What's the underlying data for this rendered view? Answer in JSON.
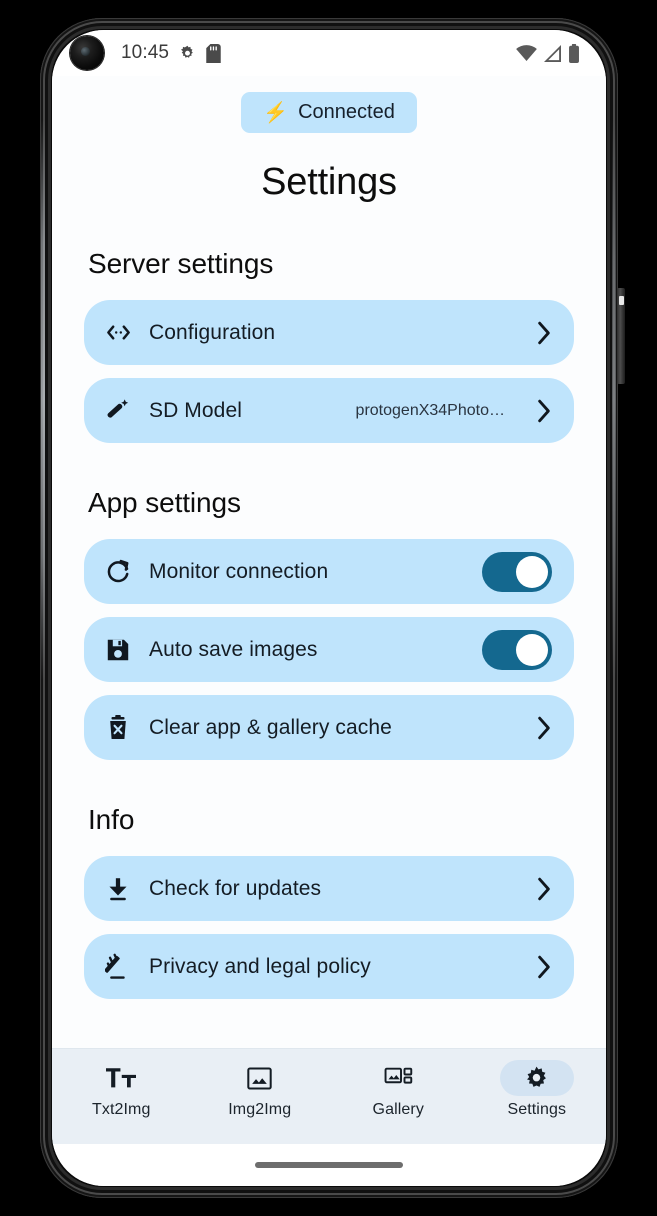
{
  "status_bar": {
    "time": "10:45",
    "icons_left": [
      "gear-icon",
      "sd-card-icon"
    ],
    "icons_right": [
      "wifi-icon",
      "cellular-signal-icon",
      "battery-icon"
    ]
  },
  "header": {
    "connection_badge": {
      "icon": "⚡",
      "label": "Connected"
    },
    "title": "Settings"
  },
  "sections": [
    {
      "header": "Server settings",
      "rows": [
        {
          "icon": "code-icon",
          "label": "Configuration",
          "value": "",
          "control": "chevron"
        },
        {
          "icon": "magic-wand-icon",
          "label": "SD Model",
          "value": "protogenX34Photo…",
          "control": "chevron"
        }
      ]
    },
    {
      "header": "App settings",
      "rows": [
        {
          "icon": "refresh-icon",
          "label": "Monitor connection",
          "value": "",
          "control": "toggle",
          "toggle_on": true
        },
        {
          "icon": "floppy-save-icon",
          "label": "Auto save images",
          "value": "",
          "control": "toggle",
          "toggle_on": true
        },
        {
          "icon": "trash-delete-icon",
          "label": "Clear app & gallery cache",
          "value": "",
          "control": "chevron"
        }
      ]
    },
    {
      "header": "Info",
      "rows": [
        {
          "icon": "download-icon",
          "label": "Check for updates",
          "value": "",
          "control": "chevron"
        },
        {
          "icon": "gavel-icon",
          "label": "Privacy and legal policy",
          "value": "",
          "control": "chevron"
        }
      ]
    }
  ],
  "bottom_nav": {
    "items": [
      {
        "icon": "text-format-icon",
        "label": "Txt2Img",
        "active": false
      },
      {
        "icon": "image-icon",
        "label": "Img2Img",
        "active": false
      },
      {
        "icon": "gallery-grid-icon",
        "label": "Gallery",
        "active": false
      },
      {
        "icon": "gear-icon",
        "label": "Settings",
        "active": true
      }
    ]
  },
  "colors": {
    "card_background": "#bfe4fc",
    "toggle_on_track": "#14688f",
    "nav_background": "#e9eff5",
    "nav_active_pill": "#d3e3f2",
    "page_background": "#fcfdfe",
    "text_primary": "#141c24"
  }
}
